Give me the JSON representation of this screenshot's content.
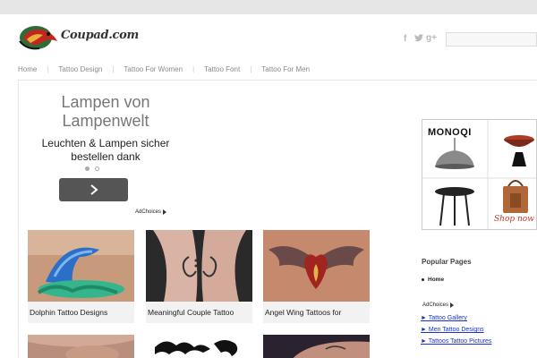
{
  "header": {
    "logo_text": "Coupad.com",
    "social": [
      "f",
      "t",
      "g+"
    ]
  },
  "nav": {
    "items": [
      "Home",
      "Tattoo Design",
      "Tattoo For Women",
      "Tattoo Font",
      "Tattoo For Men"
    ]
  },
  "ad": {
    "title": "Lampen von Lampenwelt",
    "subtitle": "Leuchten & Lampen sicher bestellen dank",
    "adchoices": "AdChoices"
  },
  "posts": [
    {
      "caption": "Dolphin Tattoo Designs"
    },
    {
      "caption": "Meaningful Couple Tattoo"
    },
    {
      "caption": "Angel Wing Tattoos for"
    }
  ],
  "sidebar": {
    "brand": "MONOQI",
    "shop_now": "Shop now",
    "popular_title": "Popular Pages",
    "popular_items": [
      "Home"
    ],
    "adchoices": "AdChoices",
    "ad_links": [
      "► Tattoo Gallery",
      "► Men Tattoo Designs",
      "► Tattoos Tattoo Pictures"
    ]
  }
}
